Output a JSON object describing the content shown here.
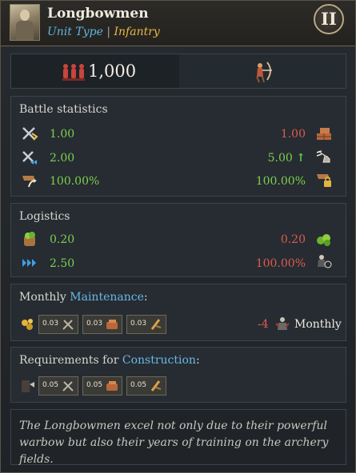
{
  "header": {
    "title": "Longbowmen",
    "unit_type_label": "Unit Type",
    "unit_type_sep": "|",
    "unit_type_value": "Infantry",
    "tier": "II"
  },
  "summary": {
    "men_count": "1,000",
    "icons": [
      "soldiers-icon",
      "archer-icon"
    ]
  },
  "battle": {
    "title": "Battle statistics",
    "rows": [
      {
        "left_icon": "melee-attack-icon",
        "left": "1.00",
        "right": "1.00",
        "right_icon": "defense-icon"
      },
      {
        "left_icon": "charge-attack-icon",
        "left": "2.00",
        "right": "5.00",
        "right_icon": "movement-icon"
      },
      {
        "left_icon": "morale-icon",
        "left": "100.00%",
        "right": "100.00%",
        "right_icon": "siege-icon"
      }
    ]
  },
  "logistics": {
    "title": "Logistics",
    "rows": [
      {
        "left_icon": "food-icon",
        "left": "0.20",
        "right": "0.20",
        "right_icon": "supply-icon"
      },
      {
        "left_icon": "speed-icon",
        "left": "2.50",
        "right": "100.00%",
        "right_icon": "reinforce-icon"
      }
    ]
  },
  "maintenance": {
    "title_prefix": "Monthly ",
    "title_hl": "Maintenance",
    "title_suffix": ":",
    "chips": [
      "0.03",
      "0.03",
      "0.03"
    ],
    "change": "-4",
    "period": "Monthly"
  },
  "requirements": {
    "title_prefix": "Requirements for ",
    "title_hl": "Construction",
    "title_suffix": ":",
    "chips": [
      "0.05",
      "0.05",
      "0.05"
    ]
  },
  "description": "The Longbowmen excel not only due to their powerful warbow but also their years of training on the archery fields.",
  "colors": {
    "positive": "#7ecf4f",
    "negative": "#e05a4e",
    "highlight": "#68b8e6",
    "unit_type": "#e6b845"
  }
}
